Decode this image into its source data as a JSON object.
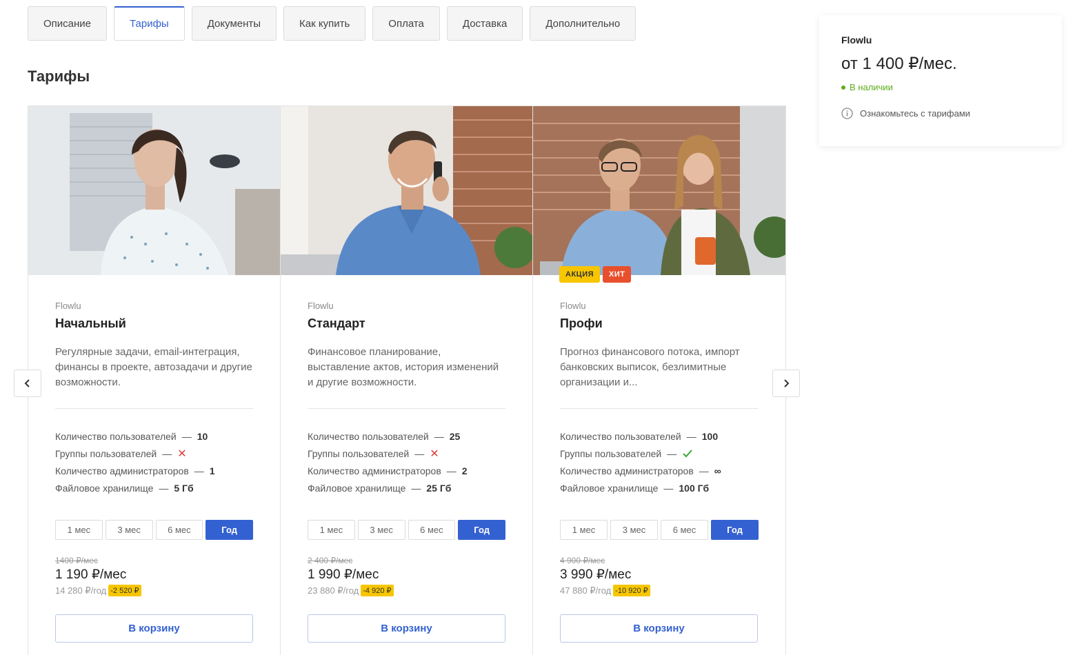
{
  "tabs": [
    "Описание",
    "Тарифы",
    "Документы",
    "Как купить",
    "Оплата",
    "Доставка",
    "Дополнительно"
  ],
  "active_tab": 1,
  "section_title": "Тарифы",
  "periods": [
    "1 мес",
    "3 мес",
    "6 мес",
    "Год"
  ],
  "cart_label": "В корзину",
  "feature_labels": [
    "Количество пользователей",
    "Группы пользователей",
    "Количество администраторов",
    "Файловое хранилище"
  ],
  "dash": "—",
  "plans": [
    {
      "brand": "Flowlu",
      "name": "Начальный",
      "description": "Регулярные задачи, email-интеграция, финансы в проекте, автозадачи и другие возможности.",
      "users": "10",
      "groups": "no",
      "admins": "1",
      "storage": "5 Гб",
      "selected_period": "Год",
      "old_price": "1400 ₽/мес",
      "price": "1 190 ₽/мес",
      "year_price": "14 280 ₽/год",
      "discount": "-2 520 ₽",
      "badges": []
    },
    {
      "brand": "Flowlu",
      "name": "Стандарт",
      "description": "Финансовое планирование, выставление актов, история изменений и другие возможности.",
      "users": "25",
      "groups": "no",
      "admins": "2",
      "storage": "25 Гб",
      "selected_period": "Год",
      "old_price": "2 400 ₽/мес",
      "price": "1 990 ₽/мес",
      "year_price": "23 880 ₽/год",
      "discount": "-4 920 ₽",
      "badges": []
    },
    {
      "brand": "Flowlu",
      "name": "Профи",
      "description": "Прогноз финансового потока, импорт банковских выписок, безлимитные организации и...",
      "users": "100",
      "groups": "yes",
      "admins": "∞",
      "storage": "100 Гб",
      "selected_period": "Год",
      "old_price": "4 900 ₽/мес",
      "price": "3 990 ₽/мес",
      "year_price": "47 880 ₽/год",
      "discount": "-10 920 ₽",
      "badges": [
        "АКЦИЯ",
        "ХИТ"
      ]
    }
  ],
  "side": {
    "brand": "Flowlu",
    "price": "от 1 400 ₽/мес.",
    "stock": "В наличии",
    "info": "Ознакомьтесь с тарифами"
  },
  "colors": {
    "accent": "#3461d1",
    "stock": "#5cac1a",
    "sale_badge": "#f7c600",
    "hit_badge": "#e8502d",
    "no_mark": "#e03c3c",
    "yes_mark": "#3aa63a"
  }
}
